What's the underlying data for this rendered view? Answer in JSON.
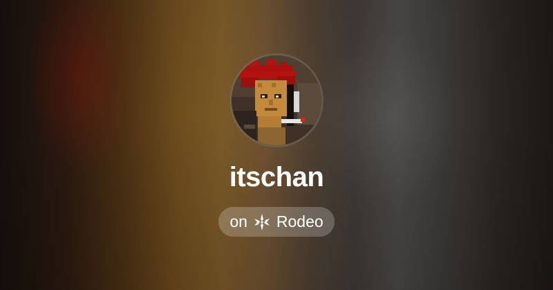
{
  "profile": {
    "username": "itschan",
    "avatar_icon": "pixel-punk-avatar"
  },
  "badge": {
    "prefix": "on",
    "platform": "Rodeo",
    "logo_icon": "rodeo-logo-icon"
  },
  "colors": {
    "text": "#ffffff",
    "pill_background": "rgba(255,255,255,0.22)",
    "hair": "#b3120f",
    "skin": "#c48a3c"
  }
}
